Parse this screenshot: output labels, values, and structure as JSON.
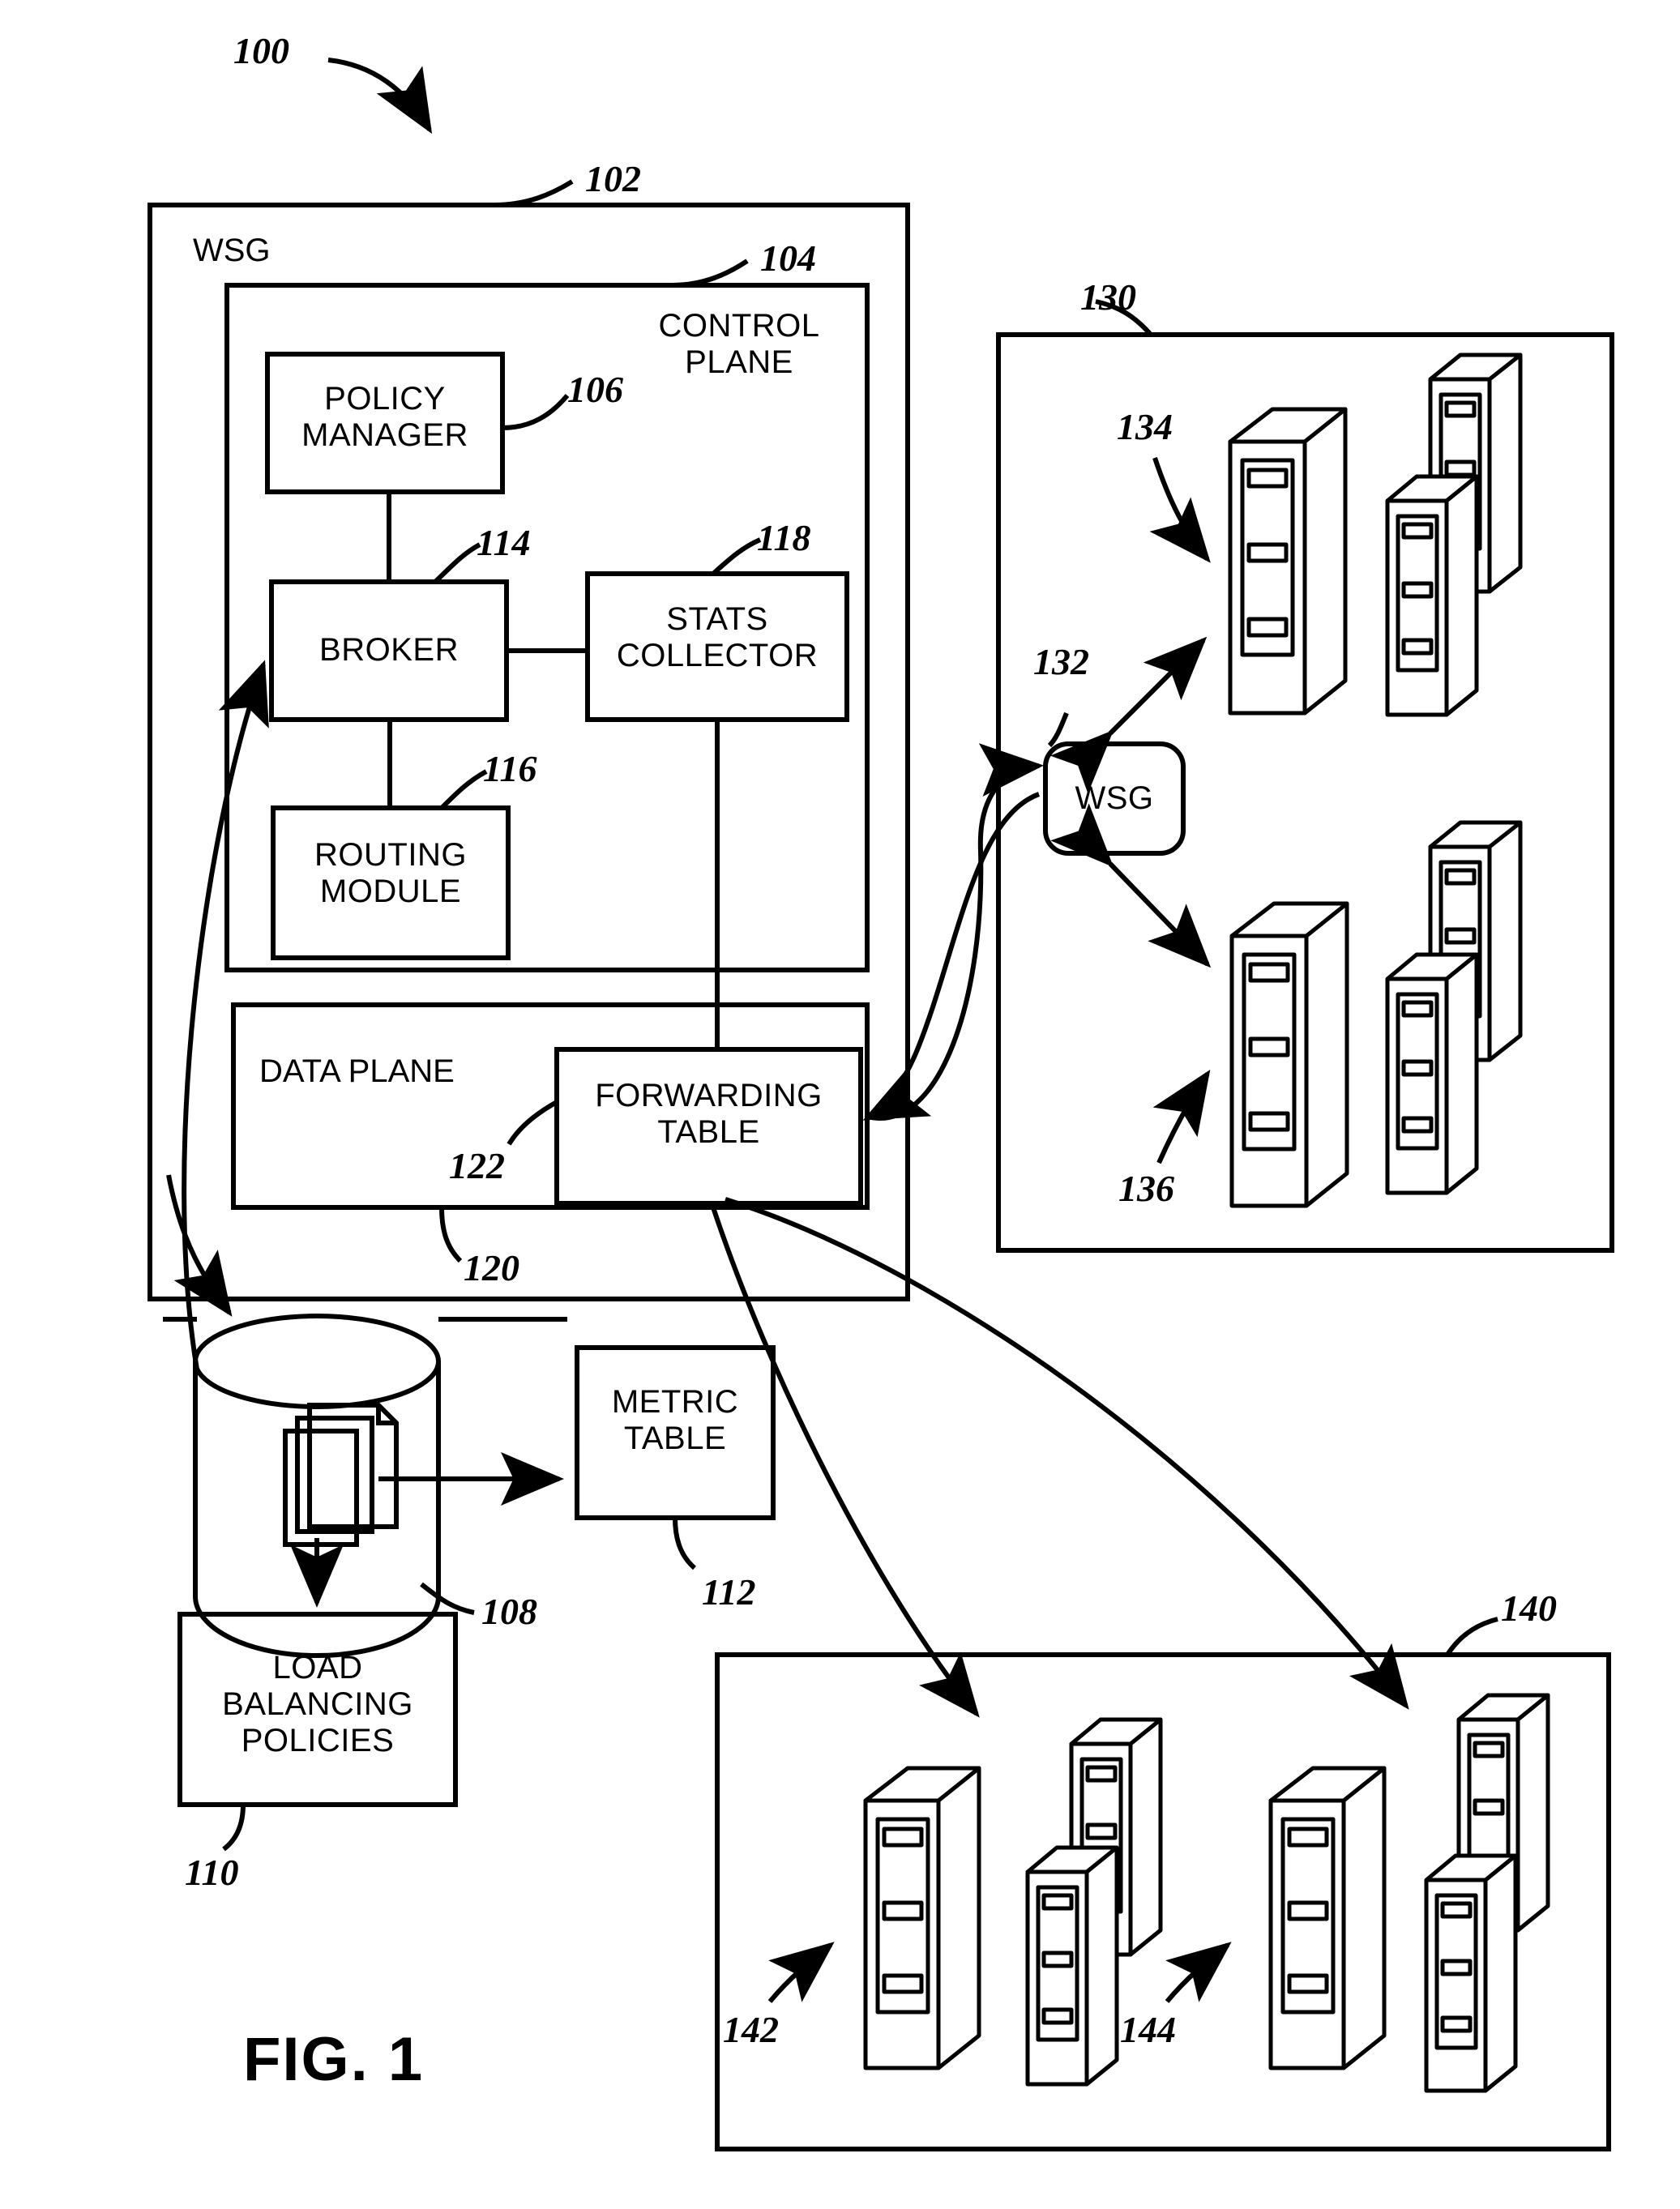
{
  "figure": {
    "caption": "FIG. 1",
    "system_ref": "100"
  },
  "wsg_main": {
    "title": "WSG",
    "ref": "102",
    "control_plane": {
      "title": "CONTROL\nPLANE",
      "ref": "104",
      "blocks": [
        {
          "label": "POLICY\nMANAGER",
          "ref": "106"
        },
        {
          "label": "BROKER",
          "ref": "114"
        },
        {
          "label": "STATS\nCOLLECTOR",
          "ref": "118"
        },
        {
          "label": "ROUTING\nMODULE",
          "ref": "116"
        }
      ]
    },
    "data_plane": {
      "title": "DATA PLANE",
      "ref": "120",
      "blocks": [
        {
          "label": "FORWARDING\nTABLE",
          "ref": "122"
        }
      ]
    }
  },
  "storage": {
    "label": "",
    "ref": "108",
    "icon": "documents-icon"
  },
  "metric_table": {
    "label": "METRIC\nTABLE",
    "ref": "112"
  },
  "load_balancing_policies": {
    "label": "LOAD\nBALANCING\nPOLICIES",
    "ref": "110"
  },
  "site_upper": {
    "ref": "130",
    "wsg_node": {
      "label": "WSG",
      "ref": "132"
    },
    "server_refs": [
      "134",
      "136"
    ],
    "server_count": 6
  },
  "site_lower": {
    "ref": "140",
    "server_refs": [
      "142",
      "144"
    ],
    "server_count": 6
  },
  "colors": {
    "stroke": "#000000",
    "background": "#ffffff"
  }
}
